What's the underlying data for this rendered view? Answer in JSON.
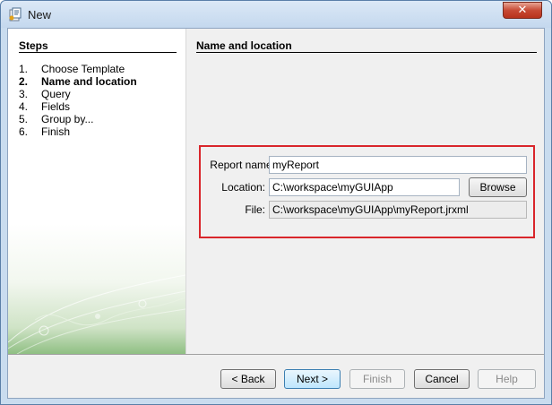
{
  "window": {
    "title": "New",
    "close_glyph": "✕"
  },
  "steps": {
    "heading": "Steps",
    "items": [
      {
        "num": "1.",
        "label": "Choose Template",
        "active": false
      },
      {
        "num": "2.",
        "label": "Name and location",
        "active": true
      },
      {
        "num": "3.",
        "label": "Query",
        "active": false
      },
      {
        "num": "4.",
        "label": "Fields",
        "active": false
      },
      {
        "num": "5.",
        "label": "Group by...",
        "active": false
      },
      {
        "num": "6.",
        "label": "Finish",
        "active": false
      }
    ]
  },
  "content": {
    "heading": "Name and location",
    "report_name_label": "Report name:",
    "report_name_value": "myReport",
    "location_label": "Location:",
    "location_value": "C:\\workspace\\myGUIApp",
    "browse_label": "Browse",
    "file_label": "File:",
    "file_value": "C:\\workspace\\myGUIApp\\myReport.jrxml",
    "highlight_color": "#d9262b"
  },
  "footer": {
    "back_label": "< Back",
    "next_label": "Next >",
    "finish_label": "Finish",
    "cancel_label": "Cancel",
    "help_label": "Help"
  }
}
